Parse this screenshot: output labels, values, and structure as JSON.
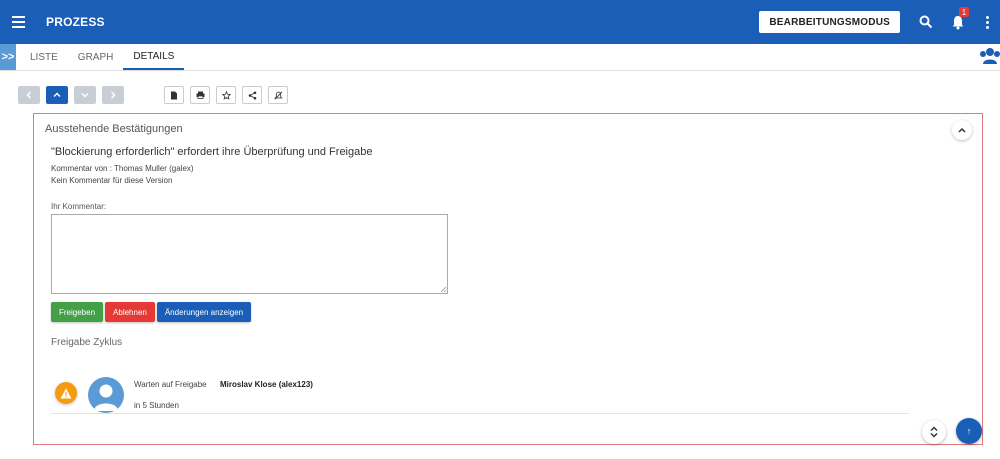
{
  "header": {
    "title": "PROZESS",
    "mode_button": "BEARBEITUNGSMODUS",
    "notification_count": "1",
    "color": "#1a5eb8"
  },
  "tabs": [
    {
      "label": "LISTE",
      "active": false
    },
    {
      "label": "GRAPH",
      "active": false
    },
    {
      "label": "DETAILS",
      "active": true
    }
  ],
  "expand_label": ">>",
  "panel": {
    "title": "Ausstehende Bestätigungen",
    "headline": "\"Blockierung erforderlich\" erfordert ihre Überprüfung und Freigabe",
    "comment_by": "Kommentar von : Thomas Muller (galex)",
    "no_comment": "Kein Kommentar für diese Version",
    "comment_label": "Ihr Kommentar:",
    "comment_value": "",
    "buttons": {
      "approve": "Freigeben",
      "reject": "Ablehnen",
      "show_changes": "Änderungen anzeigen"
    },
    "cycle_title": "Freigabe Zyklus",
    "cycle": {
      "status": "Warten auf Freigabe",
      "user": "Miroslav Klose (alex123)",
      "when": "in 5 Stunden"
    }
  },
  "icons": [
    "menu-icon",
    "search-icon",
    "bell-icon",
    "more-vert-icon",
    "people-icon",
    "chevron-left-icon",
    "chevron-up-icon",
    "chevron-down-icon",
    "chevron-right-icon",
    "file-icon",
    "print-icon",
    "star-icon",
    "share-icon",
    "unsubscribe-icon",
    "warning-icon",
    "sort-icon",
    "arrow-up-icon"
  ],
  "scroll_top_label": "↑"
}
